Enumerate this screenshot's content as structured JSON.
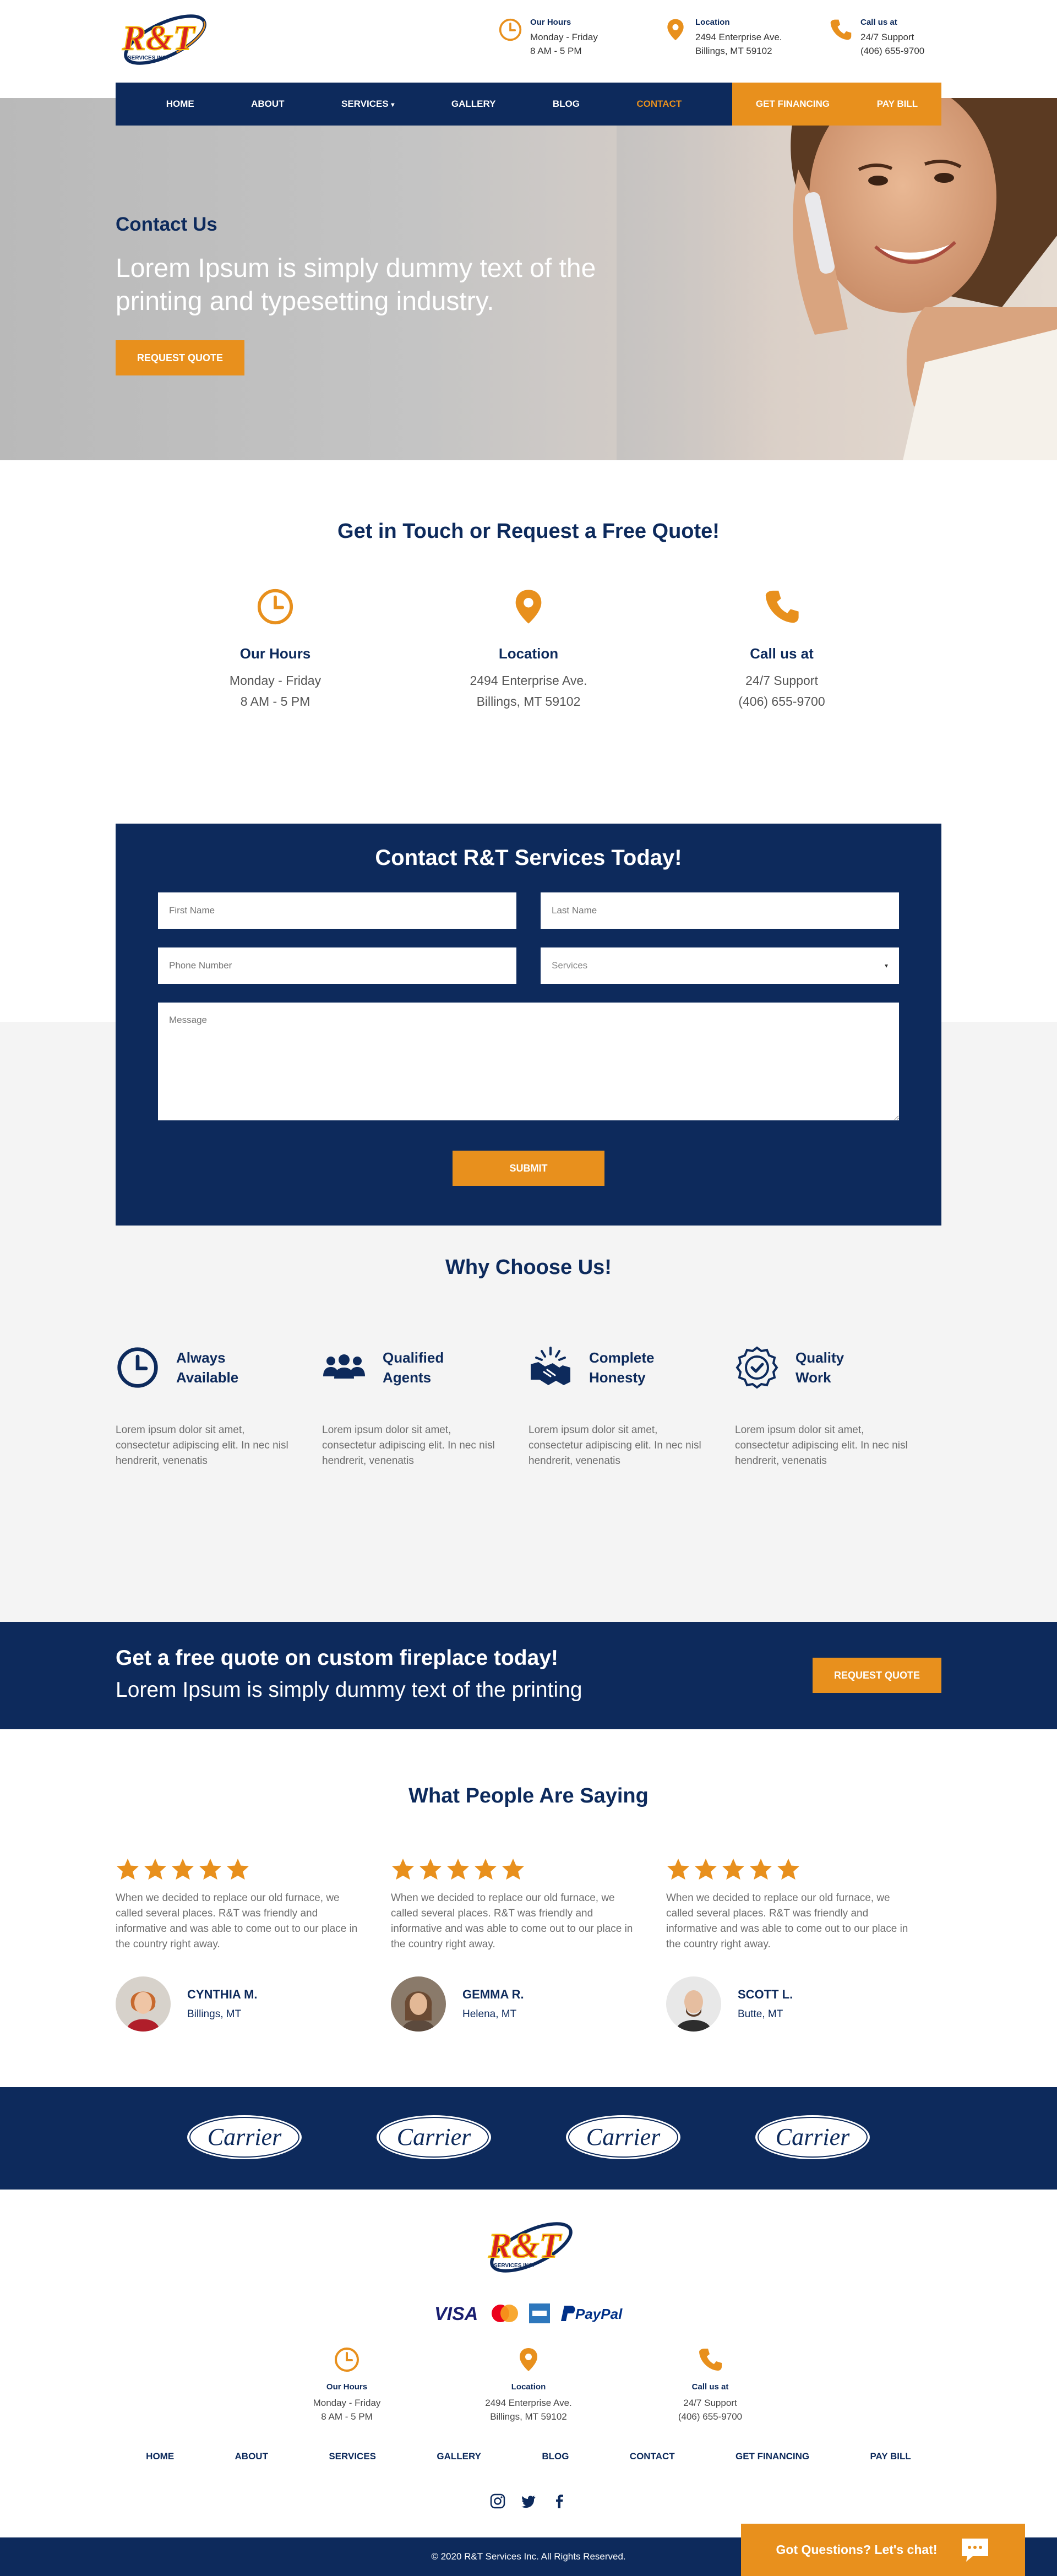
{
  "header": {
    "hours": {
      "title": "Our Hours",
      "line1": "Monday - Friday",
      "line2": "8 AM - 5 PM"
    },
    "location": {
      "title": "Location",
      "line1": "2494 Enterprise Ave.",
      "line2": "Billings, MT 59102"
    },
    "call": {
      "title": "Call us at",
      "line1": "24/7 Support",
      "line2": "(406) 655-9700"
    }
  },
  "nav": {
    "items": [
      "HOME",
      "ABOUT",
      "SERVICES",
      "GALLERY",
      "BLOG",
      "CONTACT"
    ],
    "financing": "GET FINANCING",
    "paybill": "PAY BILL"
  },
  "hero": {
    "kicker": "Contact Us",
    "title": "Lorem Ipsum is simply dummy text of the printing and typesetting industry.",
    "button": "REQUEST QUOTE"
  },
  "touch": {
    "title": "Get in Touch or Request a Free Quote!",
    "hours": {
      "title": "Our Hours",
      "line1": "Monday - Friday",
      "line2": "8 AM - 5 PM"
    },
    "location": {
      "title": "Location",
      "line1": "2494 Enterprise Ave.",
      "line2": "Billings, MT 59102"
    },
    "call": {
      "title": "Call us at",
      "line1": "24/7 Support",
      "line2": "(406) 655-9700"
    }
  },
  "form": {
    "title": "Contact R&T Services Today!",
    "first_name": "First Name",
    "last_name": "Last Name",
    "phone": "Phone Number",
    "services": "Services",
    "message": "Message",
    "submit": "SUBMIT"
  },
  "why": {
    "title": "Why Choose Us!",
    "items": [
      {
        "l1": "Always",
        "l2": "Available",
        "text": "Lorem ipsum dolor sit amet, consectetur adipiscing elit. In nec nisl hendrerit, venenatis"
      },
      {
        "l1": "Qualified",
        "l2": "Agents",
        "text": "Lorem ipsum dolor sit amet, consectetur adipiscing elit. In nec nisl hendrerit, venenatis"
      },
      {
        "l1": "Complete",
        "l2": "Honesty",
        "text": "Lorem ipsum dolor sit amet, consectetur adipiscing elit. In nec nisl hendrerit, venenatis"
      },
      {
        "l1": "Quality",
        "l2": "Work",
        "text": "Lorem ipsum dolor sit amet, consectetur adipiscing elit. In nec nisl hendrerit, venenatis"
      }
    ]
  },
  "banner": {
    "line1": "Get a free quote on custom fireplace today!",
    "line2": "Lorem Ipsum is simply dummy text of the printing",
    "button": "REQUEST QUOTE"
  },
  "testimonials": {
    "title": "What People Are Saying",
    "items": [
      {
        "rating": 5,
        "text": "When we decided to replace our old furnace, we called several places. R&T was friendly and informative and was able to come out to our place in the country right away.",
        "name": "CYNTHIA M.",
        "city": "Billings, MT"
      },
      {
        "rating": 5,
        "text": "When we decided to replace our old furnace, we called several places. R&T was friendly and informative and was able to come out to our place in the country right away.",
        "name": "GEMMA R.",
        "city": "Helena, MT"
      },
      {
        "rating": 5,
        "text": "When we decided to replace our old furnace, we called several places. R&T was friendly and informative and was able to come out to our place in the country right away.",
        "name": "SCOTT L.",
        "city": "Butte, MT"
      }
    ]
  },
  "brands": {
    "name": "Carrier"
  },
  "logo": {
    "text": "R&T",
    "sub": "SERVICES INC."
  },
  "payments": {
    "visa": "VISA",
    "paypal": "PayPal"
  },
  "footer": {
    "hours": {
      "title": "Our Hours",
      "line1": "Monday - Friday",
      "line2": "8 AM - 5 PM"
    },
    "location": {
      "title": "Location",
      "line1": "2494 Enterprise Ave.",
      "line2": "Billings, MT 59102"
    },
    "call": {
      "title": "Call us at",
      "line1": "24/7 Support",
      "line2": "(406) 655-9700"
    },
    "nav": [
      "HOME",
      "ABOUT",
      "SERVICES",
      "GALLERY",
      "BLOG",
      "CONTACT",
      "GET FINANCING",
      "PAY BILL"
    ],
    "copyright": "© 2020 R&T Services Inc. All Rights Reserved."
  },
  "chat": {
    "label": "Got Questions? Let's chat!"
  },
  "colors": {
    "navy": "#0d2a5c",
    "orange": "#e8901d",
    "light_gray": "#f4f4f4"
  }
}
